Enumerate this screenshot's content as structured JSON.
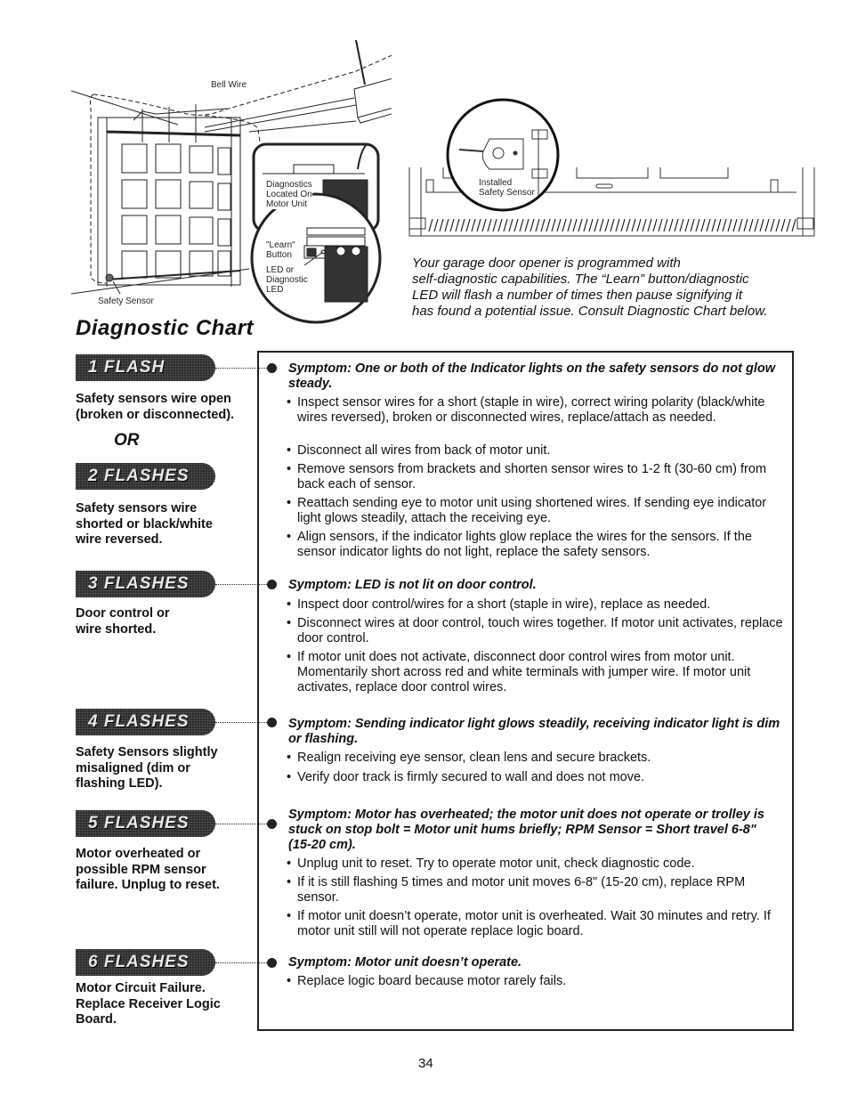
{
  "illustration": {
    "labels": {
      "bell_wire": "Bell Wire",
      "safety_sensor": "Safety Sensor",
      "diagnostics_located": [
        "Diagnostics",
        "Located On",
        "Motor Unit"
      ],
      "learn_button": [
        "\"Learn\"",
        "Button"
      ],
      "led": [
        "LED or",
        "Diagnostic",
        "LED"
      ],
      "installed_sensor": [
        "Installed",
        "Safety Sensor"
      ]
    }
  },
  "intro": {
    "lines": [
      "Your garage door opener is programmed with",
      "self-diagnostic capabilities. The “Learn” button/diagnostic",
      "LED will flash a number of times then pause signifying it",
      "has found a potential issue. Consult Diagnostic Chart below."
    ]
  },
  "title": "Diagnostic Chart",
  "or_label": "OR",
  "codes": [
    {
      "badge": "1 FLASH",
      "cause": "Safety sensors wire open (broken or disconnected)."
    },
    {
      "badge": "2 FLASHES",
      "cause": "Safety sensors wire shorted or black/white wire reversed."
    },
    {
      "badge": "3 FLASHES",
      "cause": "Door control or wire shorted.",
      "symptom": "Symptom: LED is not lit on door control.",
      "steps": [
        "Inspect door control/wires for a short (staple in wire), replace as needed.",
        "Disconnect wires at door control, touch wires together. If motor unit activates, replace door control.",
        "If motor unit does not activate, disconnect door control wires from motor unit. Momentarily short across red and white terminals with jumper wire. If motor unit activates, replace door control wires."
      ]
    },
    {
      "badge": "4 FLASHES",
      "cause": "Safety Sensors slightly misaligned (dim or flashing LED).",
      "symptom": "Symptom: Sending indicator light glows steadily, receiving indicator light is dim or flashing.",
      "steps": [
        "Realign receiving eye sensor, clean lens and secure brackets.",
        "Verify door track is firmly secured to wall and does not move."
      ]
    },
    {
      "badge": "5 FLASHES",
      "cause": "Motor overheated or possible RPM sensor failure. Unplug to reset.",
      "symptom": "Symptom: Motor has overheated; the motor unit does not operate or trolley is stuck on stop bolt = Motor unit hums briefly; RPM Sensor = Short travel 6-8\" (15-20 cm).",
      "steps": [
        "Unplug unit to reset. Try to operate motor unit, check diagnostic code.",
        "If it is still flashing 5 times and motor unit moves 6-8\" (15-20 cm), replace RPM sensor.",
        "If motor unit doesn’t operate, motor unit is overheated. Wait 30 minutes and retry. If motor unit still will not operate replace logic board."
      ]
    },
    {
      "badge": "6 FLASHES",
      "cause": "Motor Circuit Failure. Replace Receiver Logic Board.",
      "symptom": "Symptom: Motor unit doesn’t operate.",
      "steps": [
        "Replace logic board because motor rarely fails."
      ]
    }
  ],
  "sensor_symptom": {
    "symptom": "Symptom: One or both of the Indicator lights on the safety sensors do not glow steady.",
    "steps": [
      "Inspect sensor wires for a short (staple in wire), correct wiring polarity (black/white wires reversed), broken or disconnected wires, replace/attach as needed.",
      "Disconnect all wires from back of motor unit.",
      "Remove sensors from brackets and shorten sensor wires to 1-2 ft (30-60 cm) from back each of sensor.",
      "Reattach sending eye to motor unit using shortened wires. If sending eye indicator light glows steadily, attach the receiving eye.",
      "Align sensors, if the indicator lights glow replace the wires for the sensors. If the sensor indicator lights do not light, replace the safety sensors."
    ]
  },
  "page_number": "34"
}
